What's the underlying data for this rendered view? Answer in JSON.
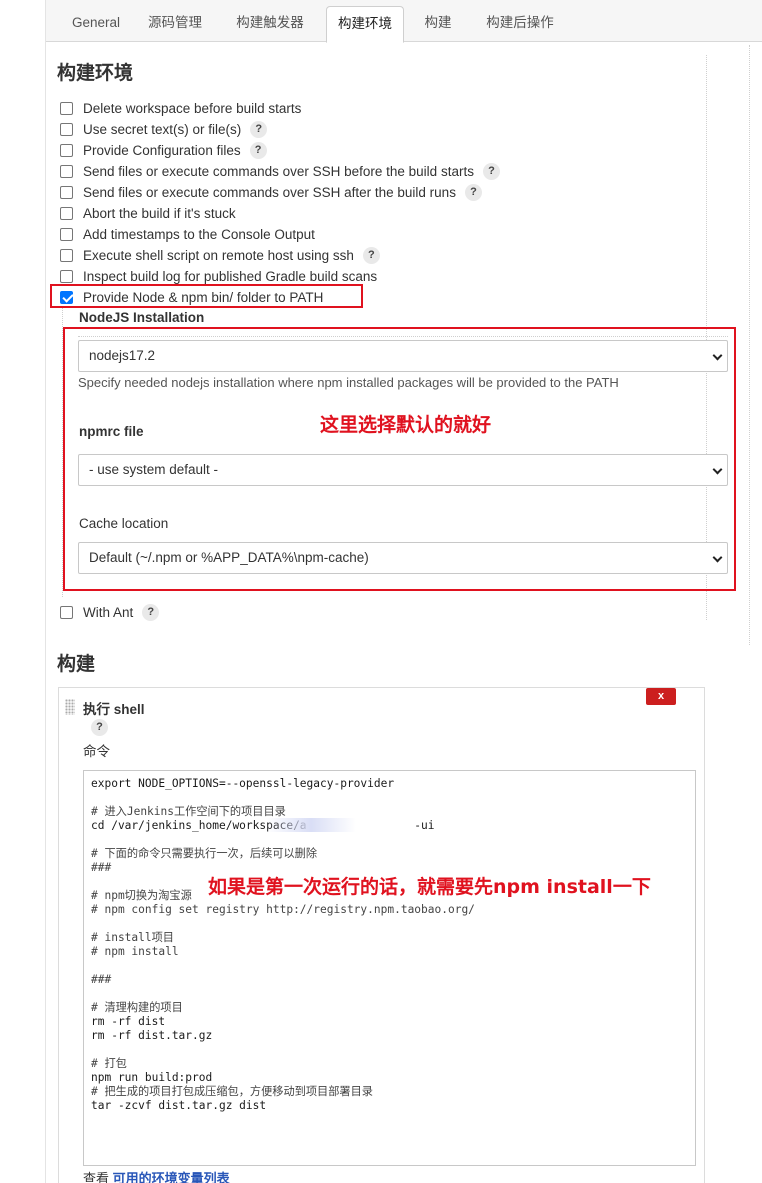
{
  "tabs": [
    "General",
    "源码管理",
    "构建触发器",
    "构建环境",
    "构建",
    "构建后操作"
  ],
  "active_tab": "构建环境",
  "env_section": {
    "title": "构建环境",
    "options": [
      {
        "label": "Delete workspace before build starts",
        "checked": false,
        "help": false
      },
      {
        "label": "Use secret text(s) or file(s)",
        "checked": false,
        "help": true
      },
      {
        "label": "Provide Configuration files",
        "checked": false,
        "help": true
      },
      {
        "label": "Send files or execute commands over SSH before the build starts",
        "checked": false,
        "help": true
      },
      {
        "label": "Send files or execute commands over SSH after the build runs",
        "checked": false,
        "help": true
      },
      {
        "label": "Abort the build if it's stuck",
        "checked": false,
        "help": false
      },
      {
        "label": "Add timestamps to the Console Output",
        "checked": false,
        "help": false
      },
      {
        "label": "Execute shell script on remote host using ssh",
        "checked": false,
        "help": true
      },
      {
        "label": "Inspect build log for published Gradle build scans",
        "checked": false,
        "help": false
      },
      {
        "label": "Provide Node & npm bin/ folder to PATH",
        "checked": true,
        "help": false
      }
    ],
    "node": {
      "installation_label": "NodeJS Installation",
      "installation_value": "nodejs17.2",
      "installation_hint": "Specify needed nodejs installation where npm installed packages will be provided to the PATH",
      "npmrc_label": "npmrc file",
      "npmrc_value": "- use system default -",
      "cache_label": "Cache location",
      "cache_value": "Default (~/.npm or %APP_DATA%\\npm-cache)"
    },
    "with_ant": {
      "label": "With Ant",
      "checked": false,
      "help": true
    }
  },
  "annotations": {
    "note1": "这里选择默认的就好",
    "note2": "如果是第一次运行的话，就需要先npm install一下"
  },
  "build_section": {
    "title": "构建",
    "step_title": "执行 shell",
    "delete_label": "x",
    "command_label": "命令",
    "code_lines": [
      "export NODE_OPTIONS=--openssl-legacy-provider",
      "",
      "# 进入Jenkins工作空间下的项目目录",
      "cd /var/jenkins_home/workspace/a                -ui",
      "",
      "# 下面的命令只需要执行一次，后续可以删除",
      "###",
      "",
      "# npm切换为淘宝源",
      "# npm config set registry http://registry.npm.taobao.org/",
      "",
      "# install项目",
      "# npm install",
      "",
      "###",
      "",
      "# 清理构建的项目",
      "rm -rf dist",
      "rm -rf dist.tar.gz",
      "",
      "# 打包",
      "npm run build:prod",
      "# 把生成的项目打包成压缩包，方便移动到项目部署目录",
      "tar -zcvf dist.tar.gz dist"
    ],
    "footer_prefix": "查看 ",
    "footer_link": "可用的环境变量列表"
  },
  "colors": {
    "annotation_red": "#e0121f",
    "checkbox_blue": "#0075ff",
    "link_blue": "#2856b8",
    "delete_red": "#cc1f1f"
  }
}
